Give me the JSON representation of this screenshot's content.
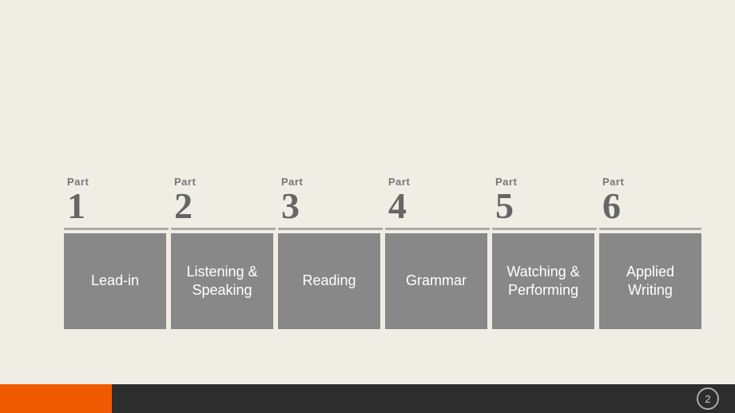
{
  "parts": [
    {
      "label": "Part",
      "number": "1",
      "text": "Lead-in"
    },
    {
      "label": "Part",
      "number": "2",
      "text": "Listening & Speaking"
    },
    {
      "label": "Part",
      "number": "3",
      "text": "Reading"
    },
    {
      "label": "Part",
      "number": "4",
      "text": "Grammar"
    },
    {
      "label": "Part",
      "number": "5",
      "text": "Watching & Performing"
    },
    {
      "label": "Part",
      "number": "6",
      "text": "Applied Writing"
    }
  ],
  "footer": {
    "page_number": "2"
  }
}
